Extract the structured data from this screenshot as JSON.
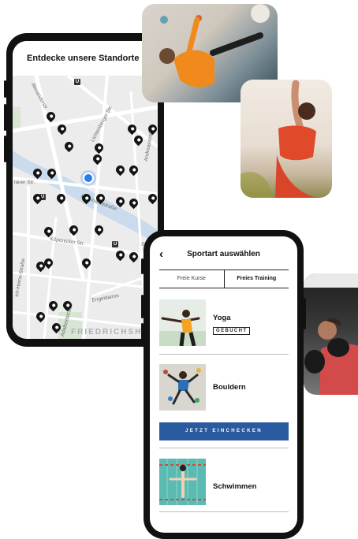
{
  "map_screen": {
    "header": "Entdecke unsere Standorte in Berlin",
    "streets": {
      "s1": "Alexanderstr.",
      "s2": "Lichtenberger Str.",
      "s3": "Andreasstraße",
      "s4": "lauer Str.",
      "s5": "Holzmarktstraße",
      "s6": "Köpenicker Str.",
      "s7": "Stralauer",
      "s8": "ich-Heine-Straße",
      "s9": "Engeldamm",
      "s10": "Adalbertstraße"
    },
    "district": "FRIEDRICHSHAIN-",
    "metro_badge": "U"
  },
  "sport_screen": {
    "back_icon": "‹",
    "title": "Sportart auswählen",
    "tabs": [
      "Freie Kurse",
      "Freies Training"
    ],
    "active_tab": "Freies Training",
    "sports": [
      {
        "name": "Yoga",
        "badge": "GEBUCHT"
      },
      {
        "name": "Bouldern"
      },
      {
        "name": "Schwimmen"
      }
    ],
    "checkin_label": "JETZT EINCHECKEN"
  },
  "colors": {
    "accent_blue": "#2a5aa0",
    "location_blue": "#2b7de9",
    "phone_frame": "#111111"
  },
  "icons": [
    "chevron-left-icon",
    "map-pin-icon",
    "current-location-icon",
    "metro-icon"
  ]
}
